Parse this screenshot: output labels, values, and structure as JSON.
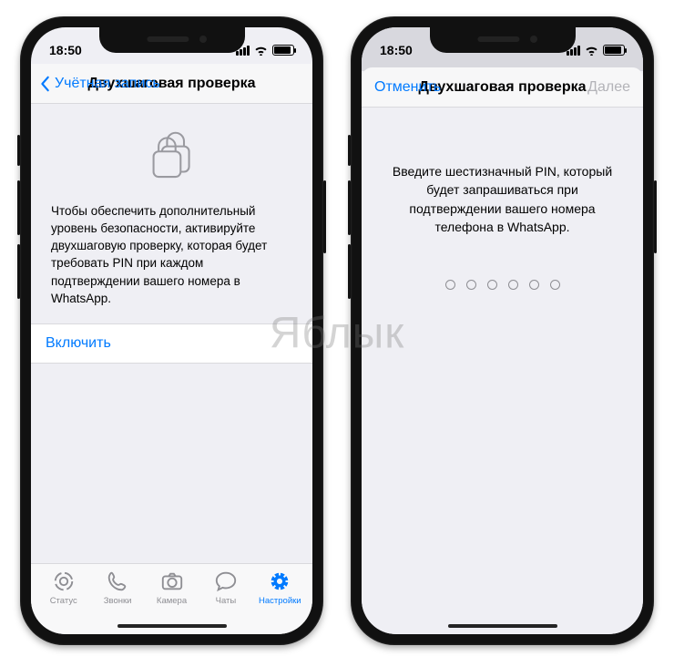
{
  "watermark": "Яблык",
  "status": {
    "time": "18:50"
  },
  "phone1": {
    "nav": {
      "back": "Учётная запись",
      "title": "Двухшаговая проверка"
    },
    "description": "Чтобы обеспечить дополнительный уровень безопасности, активируйте двухшаговую проверку, которая будет требовать PIN при каждом подтверждении вашего номера в WhatsApp.",
    "enable": "Включить",
    "tabs": {
      "status": "Статус",
      "calls": "Звонки",
      "camera": "Камера",
      "chats": "Чаты",
      "settings": "Настройки"
    }
  },
  "phone2": {
    "nav": {
      "cancel": "Отменить",
      "title": "Двухшаговая проверка",
      "next": "Далее"
    },
    "description": "Введите шестизначный PIN, который будет запрашиваться при подтверждении вашего номера телефона в WhatsApp.",
    "pin_length": 6
  }
}
